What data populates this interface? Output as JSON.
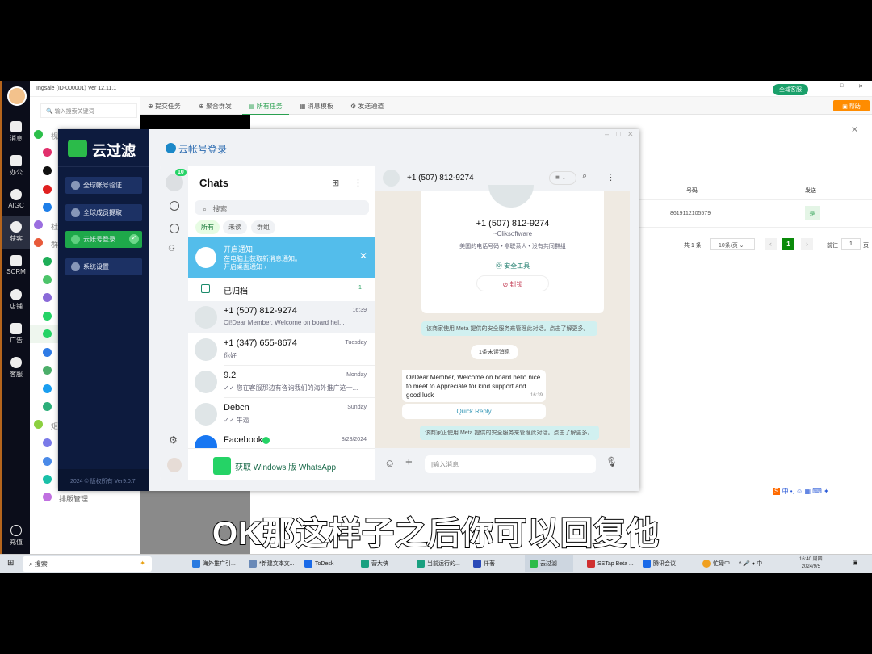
{
  "app": {
    "title": "Ingsale (ID-000001) Ver 12.11.1",
    "search_placeholder": "输入搜索关键词",
    "service_badge": "全域客服",
    "help_button": "帮助"
  },
  "nav": [
    {
      "label": "消息"
    },
    {
      "label": "办公"
    },
    {
      "label": "AIGC"
    },
    {
      "label": "获客",
      "active": true
    },
    {
      "label": "SCRM"
    },
    {
      "label": "店铺"
    },
    {
      "label": "广告"
    },
    {
      "label": "客服"
    },
    {
      "label": "充值"
    }
  ],
  "leftcol": {
    "group1": "视",
    "group2": "社",
    "group3": "群",
    "group4": "矩",
    "layout_manage": "排版管理"
  },
  "tabs": [
    {
      "label": "提交任务"
    },
    {
      "label": "聚合群发"
    },
    {
      "label": "所有任务",
      "active": true
    },
    {
      "label": "消息模板"
    },
    {
      "label": "发送通道"
    }
  ],
  "yun": {
    "brand": "云过滤",
    "title": "云帐号登录",
    "menu": [
      {
        "label": "全球帐号验证"
      },
      {
        "label": "全球成员提取"
      },
      {
        "label": "云帐号登录",
        "active": true
      },
      {
        "label": "系统设置"
      }
    ],
    "footer": "2024 © 版权所有 Ver9.0.7"
  },
  "whatsapp": {
    "badge": "10",
    "chats_title": "Chats",
    "search_placeholder": "搜索",
    "filters": [
      "所有",
      "未读",
      "群组"
    ],
    "notify": {
      "title": "开启通知",
      "line1": "在电脑上获取新消息通知。",
      "line2": "开启桌面通知 ›"
    },
    "archived": {
      "label": "已归档",
      "count": "1"
    },
    "chats": [
      {
        "name": "+1 (507) 812-9274",
        "time": "16:39",
        "preview": "Oi!Dear Member, Welcome on board hel...",
        "selected": true
      },
      {
        "name": "+1 (347) 655-8674",
        "time": "Tuesday",
        "preview": "你好"
      },
      {
        "name": "9.2",
        "time": "Monday",
        "preview": "✓✓ 您在客服那边有咨询我们的海外推广这一..."
      },
      {
        "name": "Debcn",
        "time": "Sunday",
        "preview": "✓✓ 牛逼"
      },
      {
        "name": "Facebook",
        "time": "8/28/2024",
        "preview": ""
      }
    ],
    "get_windows": "获取 Windows 版 WhatsApp",
    "conv": {
      "header_name": "+1 (507) 812-9274",
      "profile_name": "+1 (507) 812-9274",
      "profile_sub": "~Cliksoftware",
      "profile_info": "美国的电话号码 • 非联系人 • 没有共同群组",
      "safety": "安全工具",
      "block": "封锁",
      "sys1": "该商家使用 Meta 提供的安全服务来管理此对话。点击了解更多。",
      "unread": "1条未读消息",
      "message": "Oi!Dear Member, Welcome on board hello nice to meet to  Appreciate for kind support and good luck",
      "message_time": "16:39",
      "quick_reply": "Quick Reply",
      "sys2": "该商家正使用 Meta 提供的安全服务来管理此对话。点击了解更多。",
      "input_placeholder": "输入消息"
    }
  },
  "task_panel": {
    "col_number": "号码",
    "col_send": "发送",
    "row_number": "8619112105579",
    "row_send": "是",
    "total": "共 1 条",
    "per_page": "10条/页",
    "page": "1",
    "goto": "前往",
    "goto_value": "1",
    "page_unit": "页"
  },
  "subtitle": "OK那这样子之后你可以回复他",
  "taskbar": {
    "search": "搜索",
    "items": [
      "海外推广引...",
      "*新建文本文...",
      "ToDesk",
      "营大侠",
      "当前运行的...",
      "仟著",
      "云过滤",
      "SSTap Beta ...",
      "腾讯会议"
    ],
    "tray_text": "忙碌中",
    "ime": "中",
    "time": "16:40 周四",
    "date": "2024/9/5"
  },
  "colors": {
    "wa_green": "#25d366",
    "notify_blue": "#53bdeb",
    "nav_dark": "#0b0d1a",
    "yun_navy": "#0d1b3e",
    "active_green": "#1ea84a",
    "help_orange": "#ff8c00"
  }
}
